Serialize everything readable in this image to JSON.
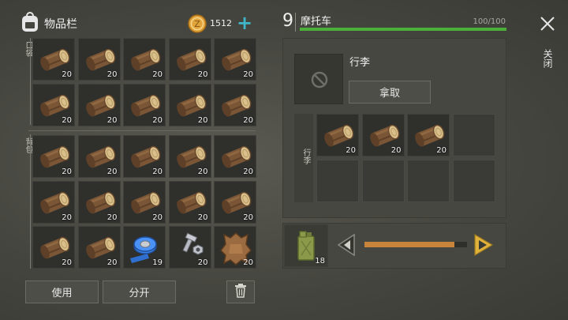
{
  "header": {
    "title": "物品栏",
    "coins": "1512",
    "plus": "+"
  },
  "inventory": {
    "pocket_label": "口袋",
    "backpack_label": "背包",
    "pocket": [
      {
        "item": "log",
        "count": "20"
      },
      {
        "item": "log",
        "count": "20"
      },
      {
        "item": "log",
        "count": "20"
      },
      {
        "item": "log",
        "count": "20"
      },
      {
        "item": "log",
        "count": "20"
      },
      {
        "item": "log",
        "count": "20"
      },
      {
        "item": "log",
        "count": "20"
      },
      {
        "item": "log",
        "count": "20"
      },
      {
        "item": "log",
        "count": "20"
      },
      {
        "item": "log",
        "count": "20"
      }
    ],
    "backpack": [
      {
        "item": "log",
        "count": "20"
      },
      {
        "item": "log",
        "count": "20"
      },
      {
        "item": "log",
        "count": "20"
      },
      {
        "item": "log",
        "count": "20"
      },
      {
        "item": "log",
        "count": "20"
      },
      {
        "item": "log",
        "count": "20"
      },
      {
        "item": "log",
        "count": "20"
      },
      {
        "item": "log",
        "count": "20"
      },
      {
        "item": "log",
        "count": "20"
      },
      {
        "item": "log",
        "count": "20"
      },
      {
        "item": "log",
        "count": "20"
      },
      {
        "item": "log",
        "count": "20"
      },
      {
        "item": "duct-tape",
        "count": "19"
      },
      {
        "item": "nuts-bolts",
        "count": "20"
      },
      {
        "item": "leather",
        "count": "20"
      }
    ]
  },
  "actions": {
    "use": "使用",
    "split": "分开"
  },
  "vehicle": {
    "level": "9",
    "name": "摩托车",
    "durability": "100/100",
    "durability_fraction": 1.0,
    "close_label": "关闭"
  },
  "luggage": {
    "title": "行李",
    "take_button": "拿取",
    "side_label": "行李",
    "slots": [
      {
        "item": "log",
        "count": "20"
      },
      {
        "item": "log",
        "count": "20"
      },
      {
        "item": "log",
        "count": "20"
      },
      {
        "item": "",
        "count": ""
      },
      {
        "item": "",
        "count": ""
      },
      {
        "item": "",
        "count": ""
      },
      {
        "item": "",
        "count": ""
      },
      {
        "item": "",
        "count": ""
      }
    ]
  },
  "fuel": {
    "count": "18",
    "slider_fraction": 0.88
  },
  "colors": {
    "durability_bar": "#4caf3a",
    "coin": "#e0a43a",
    "plus": "#3fb6c8",
    "slider": "#c8843a",
    "arrow": "#e0b23a"
  }
}
